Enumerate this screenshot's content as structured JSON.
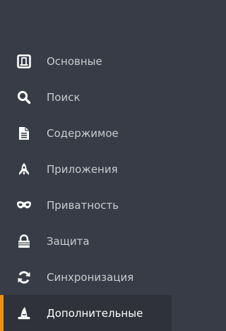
{
  "sidebar": {
    "items": [
      {
        "label": "Основные",
        "icon": "general-icon"
      },
      {
        "label": "Поиск",
        "icon": "search-icon"
      },
      {
        "label": "Содержимое",
        "icon": "document-icon"
      },
      {
        "label": "Приложения",
        "icon": "rocket-icon"
      },
      {
        "label": "Приватность",
        "icon": "mask-icon"
      },
      {
        "label": "Защита",
        "icon": "lock-icon"
      },
      {
        "label": "Синхронизация",
        "icon": "sync-icon"
      },
      {
        "label": "Дополнительные",
        "icon": "wizard-hat-icon",
        "selected": true
      }
    ]
  },
  "colors": {
    "background": "#383c46",
    "selected_background": "#2f323b",
    "accent": "#f0920d",
    "text": "#c9cbd0",
    "icon": "#ffffff"
  }
}
